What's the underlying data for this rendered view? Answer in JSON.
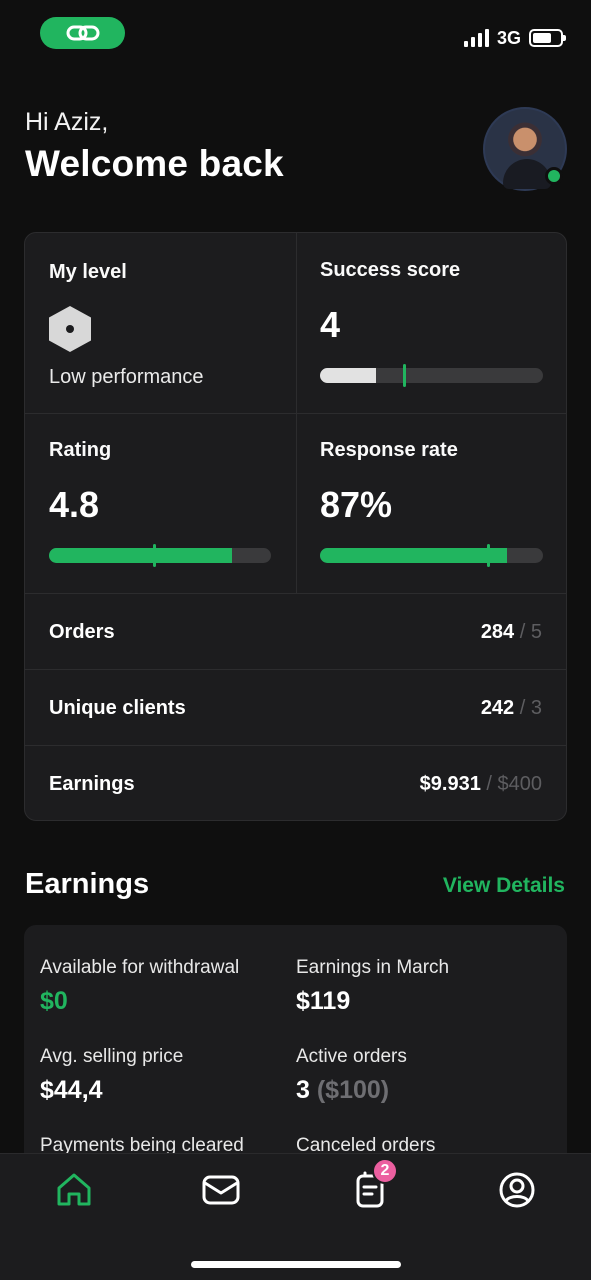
{
  "status_bar": {
    "network": "3G",
    "icons": [
      "link-icon",
      "signal-icon",
      "battery-icon"
    ]
  },
  "greeting": {
    "small": "Hi Aziz,",
    "big": "Welcome back"
  },
  "stats": {
    "level": {
      "label": "My level",
      "status": "Low performance",
      "icon": "hexagon-level-icon"
    },
    "success_score": {
      "label": "Success score",
      "value": "4",
      "progress": 0.25,
      "target": 0.37
    },
    "rating": {
      "label": "Rating",
      "value": "4.8",
      "progress": 0.825,
      "target": 0.47
    },
    "response_rate": {
      "label": "Response rate",
      "value": "87%",
      "progress": 0.84,
      "target": 0.75
    },
    "rows": [
      {
        "label": "Orders",
        "value": "284",
        "separator": "/",
        "target": "5"
      },
      {
        "label": "Unique clients",
        "value": "242",
        "separator": "/",
        "target": "3"
      },
      {
        "label": "Earnings",
        "value": "$9.931",
        "separator": "/",
        "target": "$400"
      }
    ]
  },
  "earnings": {
    "title": "Earnings",
    "view_details": "View Details",
    "items": [
      {
        "label": "Available for withdrawal",
        "value": "$0",
        "accent": true
      },
      {
        "label": "Earnings in March",
        "value": "$119"
      },
      {
        "label": "Avg. selling price",
        "value": "$44,4"
      },
      {
        "label": "Active orders",
        "value": "3",
        "extra": "($100)"
      },
      {
        "label": "Payments being cleared",
        "value": ""
      },
      {
        "label": "Canceled orders",
        "value": ""
      }
    ]
  },
  "tab_bar": {
    "tabs": [
      {
        "name": "home",
        "icon": "home-icon",
        "active": true
      },
      {
        "name": "messages",
        "icon": "envelope-icon"
      },
      {
        "name": "orders",
        "icon": "clipboard-icon",
        "badge": "2"
      },
      {
        "name": "profile",
        "icon": "user-circle-icon"
      }
    ]
  },
  "colors": {
    "accent": "#21b55f",
    "background": "#0f0f0f",
    "card": "#1c1c1e",
    "badge": "#ec5fa0"
  }
}
